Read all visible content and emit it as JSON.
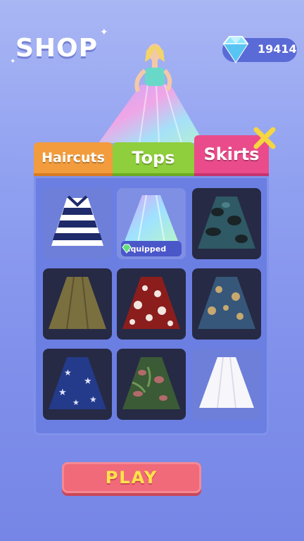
{
  "header": {
    "title": "SHOP"
  },
  "currency": {
    "amount": "19414",
    "icon": "diamond-icon"
  },
  "tabs": [
    {
      "label": "Haircuts",
      "color": "#f29c3d"
    },
    {
      "label": "Tops",
      "color": "#8fce3c"
    },
    {
      "label": "Skirts",
      "color": "#ea4b8b",
      "active": true
    }
  ],
  "items": [
    {
      "name": "striped-skirt",
      "equipped": false
    },
    {
      "name": "holographic-skirt",
      "equipped": true,
      "badge": "Equipped"
    },
    {
      "name": "camo-skirt",
      "equipped": false
    },
    {
      "name": "olive-skirt",
      "equipped": false
    },
    {
      "name": "red-polka-skirt",
      "equipped": false
    },
    {
      "name": "floral-blue-skirt",
      "equipped": false
    },
    {
      "name": "star-skirt",
      "equipped": false
    },
    {
      "name": "tropical-skirt",
      "equipped": false
    },
    {
      "name": "white-skirt",
      "equipped": false
    }
  ],
  "play": {
    "label": "PLAY"
  }
}
